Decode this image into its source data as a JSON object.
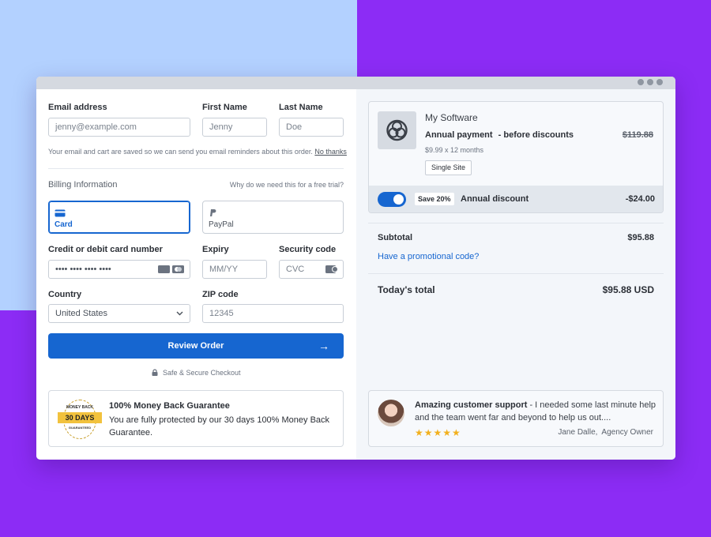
{
  "form": {
    "email_label": "Email address",
    "email_placeholder": "jenny@example.com",
    "first_name_label": "First Name",
    "first_name_placeholder": "Jenny",
    "last_name_label": "Last Name",
    "last_name_placeholder": "Doe",
    "save_note": "Your email and cart are saved so we can send you email reminders about this order.",
    "no_thanks": "No thanks",
    "billing_title": "Billing Information",
    "billing_why": "Why do we need this for a free trial?",
    "payment_methods": [
      {
        "label": "Card",
        "icon": "card-icon",
        "selected": true
      },
      {
        "label": "PayPal",
        "icon": "paypal-icon",
        "selected": false
      }
    ],
    "card_number_label": "Credit or debit card number",
    "card_number_placeholder": "•••• •••• •••• ••••",
    "expiry_label": "Expiry",
    "expiry_placeholder": "MM/YY",
    "security_label": "Security code",
    "security_placeholder": "CVC",
    "country_label": "Country",
    "country_value": "United States",
    "zip_label": "ZIP code",
    "zip_placeholder": "12345",
    "review_button": "Review Order",
    "secure_text": "Safe & Secure Checkout"
  },
  "guarantee": {
    "seal_top": "MONEY BACK",
    "seal_days": "30 DAYS",
    "seal_bottom": "GUARANTEED",
    "title": "100% Money Back Guarantee",
    "text": "You are fully protected by our 30 days 100% Money Back Guarantee."
  },
  "order": {
    "product_name": "My Software",
    "payment_type": "Annual payment",
    "payment_note": "- before discounts",
    "original_price": "$119.88",
    "breakdown": "$9.99 x 12 months",
    "plan": "Single Site",
    "save_badge": "Save 20%",
    "discount_label": "Annual discount",
    "discount_amount": "-$24.00",
    "subtotal_label": "Subtotal",
    "subtotal_value": "$95.88",
    "promo_link": "Have a promotional code?",
    "total_label": "Today's total",
    "total_value": "$95.88 USD"
  },
  "testimonial": {
    "headline": "Amazing customer support",
    "text": " - I needed some last minute help and the team went far and beyond to help us out....",
    "stars": "★★★★★",
    "author": "Jane Dalle,  Agency Owner"
  },
  "colors": {
    "accent": "#1666d0",
    "background_purple": "#8c2cf5",
    "background_blue": "#b3d1ff",
    "star": "#f2b01e"
  }
}
